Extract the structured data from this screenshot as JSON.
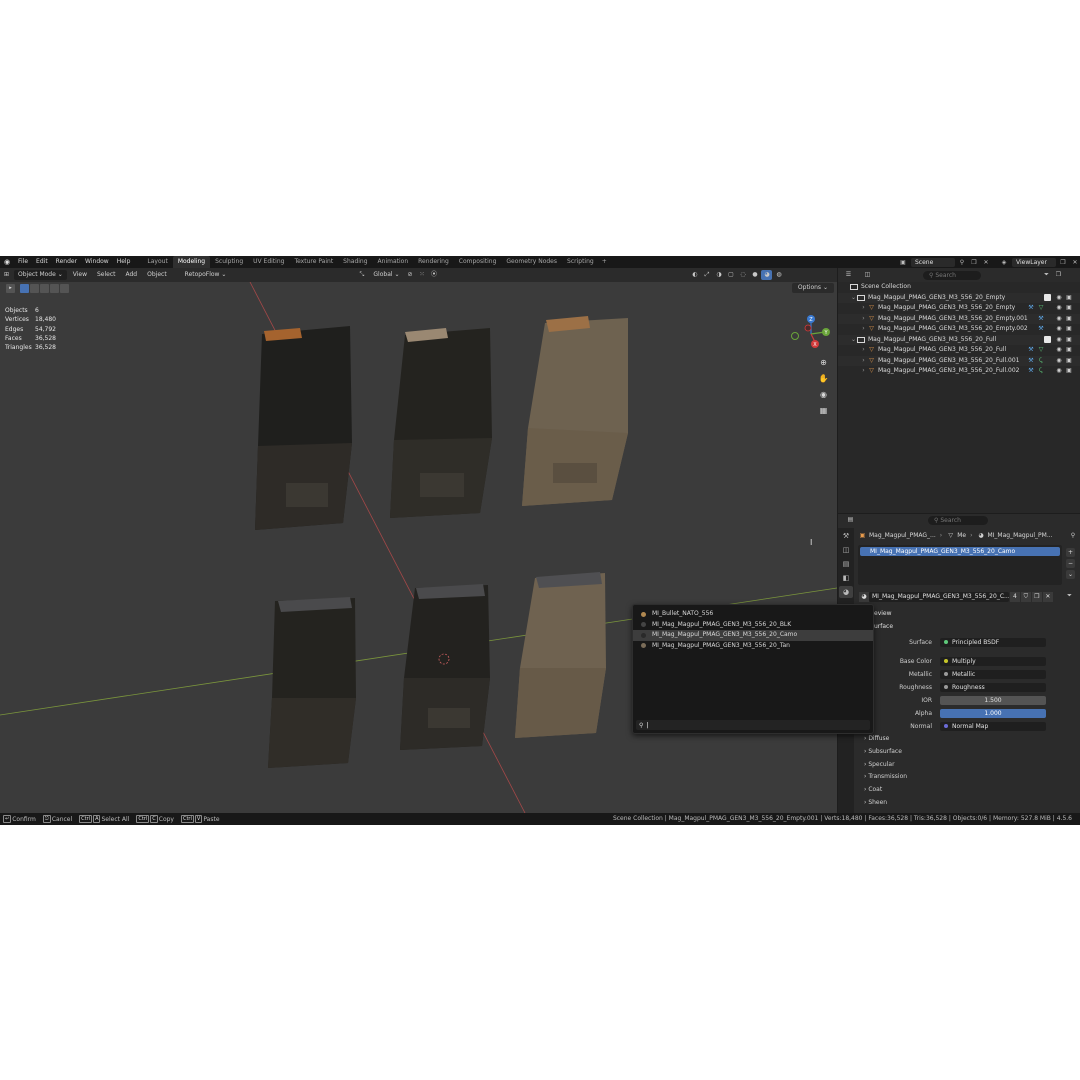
{
  "menu": {
    "items": [
      "File",
      "Edit",
      "Render",
      "Window",
      "Help"
    ]
  },
  "workspaces": {
    "tabs": [
      "Layout",
      "Modeling",
      "Sculpting",
      "UV Editing",
      "Texture Paint",
      "Shading",
      "Animation",
      "Rendering",
      "Compositing",
      "Geometry Nodes",
      "Scripting"
    ],
    "active": "Modeling"
  },
  "topright": {
    "scene": "Scene",
    "view_layer": "ViewLayer"
  },
  "viewport": {
    "mode": "Object Mode",
    "menus": [
      "View",
      "Select",
      "Add",
      "Object",
      "RetopoFlow"
    ],
    "orientation": "Global",
    "options": "Options",
    "stats": [
      {
        "label": "Objects",
        "value": "6"
      },
      {
        "label": "Vertices",
        "value": "18,480"
      },
      {
        "label": "Edges",
        "value": "54,792"
      },
      {
        "label": "Faces",
        "value": "36,528"
      },
      {
        "label": "Triangles",
        "value": "36,528"
      }
    ],
    "gizmo": {
      "x": "X",
      "y": "Y",
      "z": "Z"
    }
  },
  "outliner": {
    "search_placeholder": "Search",
    "scene_collection": "Scene Collection",
    "rows": [
      {
        "name": "Mag_Magpul_PMAG_GEN3_M3_556_20_Empty",
        "type": "collection"
      },
      {
        "name": "Mag_Magpul_PMAG_GEN3_M3_556_20_Empty",
        "type": "object"
      },
      {
        "name": "Mag_Magpul_PMAG_GEN3_M3_556_20_Empty.001",
        "type": "object"
      },
      {
        "name": "Mag_Magpul_PMAG_GEN3_M3_556_20_Empty.002",
        "type": "object"
      },
      {
        "name": "Mag_Magpul_PMAG_GEN3_M3_556_20_Full",
        "type": "collection"
      },
      {
        "name": "Mag_Magpul_PMAG_GEN3_M3_556_20_Full",
        "type": "object"
      },
      {
        "name": "Mag_Magpul_PMAG_GEN3_M3_556_20_Full.001",
        "type": "object"
      },
      {
        "name": "Mag_Magpul_PMAG_GEN3_M3_556_20_Full.002",
        "type": "object"
      }
    ]
  },
  "properties": {
    "search_placeholder": "Search",
    "breadcrumb": [
      "Mag_Magpul_PMAG_...",
      "Me",
      "MI_Mag_Magpul_PM..."
    ],
    "slot": "MI_Mag_Magpul_PMAG_GEN3_M3_556_20_Camo",
    "material_field": "MI_Mag_Magpul_PMAG_GEN3_M3_556_20_C...",
    "users": "4",
    "preview": "eview",
    "surface_panel": "urface",
    "rows": [
      {
        "label": "Surface",
        "value": "Principled BSDF"
      },
      {
        "label": "Base Color",
        "value": "Multiply"
      },
      {
        "label": "Metallic",
        "value": "Metallic"
      },
      {
        "label": "Roughness",
        "value": "Roughness"
      },
      {
        "label": "IOR",
        "value": "1.500"
      },
      {
        "label": "Alpha",
        "value": "1.000"
      },
      {
        "label": "Normal",
        "value": "Normal Map"
      }
    ],
    "subpanels": [
      "Diffuse",
      "Subsurface",
      "Specular",
      "Transmission",
      "Coat",
      "Sheen"
    ]
  },
  "popup": {
    "items": [
      "MI_Bullet_NATO_556",
      "MI_Mag_Magpul_PMAG_GEN3_M3_556_20_BLK",
      "MI_Mag_Magpul_PMAG_GEN3_M3_556_20_Camo",
      "MI_Mag_Magpul_PMAG_GEN3_M3_556_20_Tan"
    ],
    "highlighted": "MI_Mag_Magpul_PMAG_GEN3_M3_556_20_Camo"
  },
  "statusbar": {
    "confirm": "Confirm",
    "cancel": "Cancel",
    "key_ctrl": "Ctrl",
    "key_a": "A",
    "select_all": "Select All",
    "key_c": "C",
    "copy": "Copy",
    "key_v": "V",
    "paste": "Paste",
    "info": "Scene Collection | Mag_Magpul_PMAG_GEN3_M3_556_20_Empty.001 | Verts:18,480 | Faces:36,528 | Tris:36,528 | Objects:0/6 | Memory: 527.8 MiB | 4.5.6"
  },
  "colors": {
    "accent": "#4772b3",
    "viewport_bg": "#3b3b3b",
    "axis_red": "#b04848",
    "axis_green": "#7a9a3a",
    "gizmo_x": "#d13b3b",
    "gizmo_y": "#6aa53a",
    "gizmo_z": "#3a7ad1"
  }
}
